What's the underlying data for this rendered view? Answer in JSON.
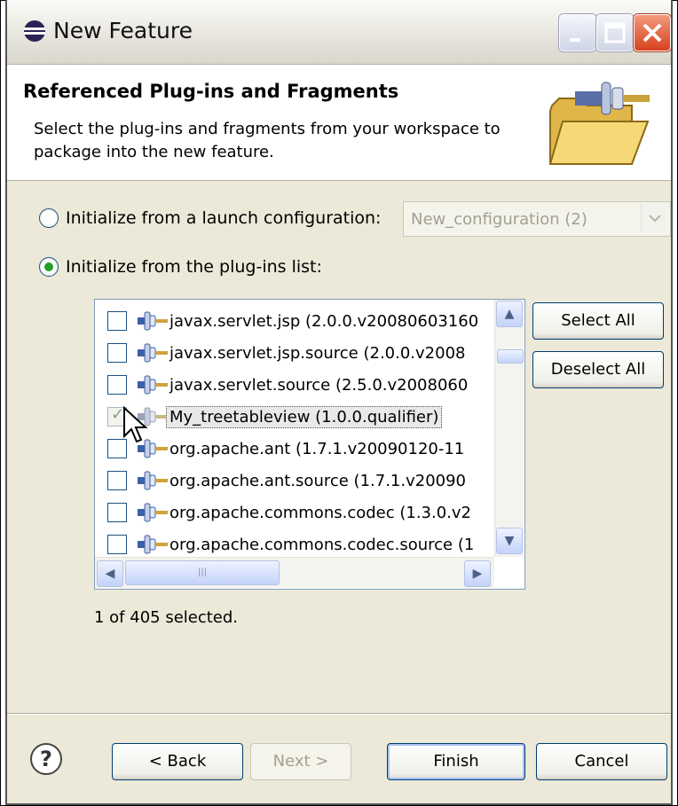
{
  "window": {
    "title": "New Feature",
    "minimize_icon": "minimize-icon",
    "maximize_icon": "maximize-icon",
    "close_icon": "close-icon"
  },
  "header": {
    "title": "Referenced Plug-ins and Fragments",
    "description": "Select the plug-ins and fragments from your workspace to package into the new feature.",
    "icon": "folder-plugin-icon"
  },
  "init_options": {
    "launch_config_label": "Initialize from a launch configuration:",
    "launch_config_selected": false,
    "launch_config_value": "New_configuration (2)",
    "plugins_list_label": "Initialize from the plug-ins list:",
    "plugins_list_selected": true
  },
  "plugins": [
    {
      "label": "javax.servlet.jsp (2.0.0.v20080603160",
      "checked": false
    },
    {
      "label": "javax.servlet.jsp.source (2.0.0.v2008",
      "checked": false
    },
    {
      "label": "javax.servlet.source (2.5.0.v2008060",
      "checked": false
    },
    {
      "label": "My_treetableview (1.0.0.qualifier)",
      "checked": true,
      "selected": true
    },
    {
      "label": "org.apache.ant (1.7.1.v20090120-11",
      "checked": false
    },
    {
      "label": "org.apache.ant.source (1.7.1.v20090",
      "checked": false
    },
    {
      "label": "org.apache.commons.codec (1.3.0.v2",
      "checked": false
    },
    {
      "label": "org.apache.commons.codec.source (1",
      "checked": false
    }
  ],
  "list_buttons": {
    "select_all": "Select All",
    "deselect_all": "Deselect All"
  },
  "status": "1 of 405 selected.",
  "footer": {
    "help_icon": "help-icon",
    "back": "< Back",
    "next": "Next >",
    "finish": "Finish",
    "cancel": "Cancel"
  },
  "colors": {
    "dialog_bg": "#ece9d8",
    "accent_green": "#21a121",
    "border_blue": "#003c74"
  }
}
